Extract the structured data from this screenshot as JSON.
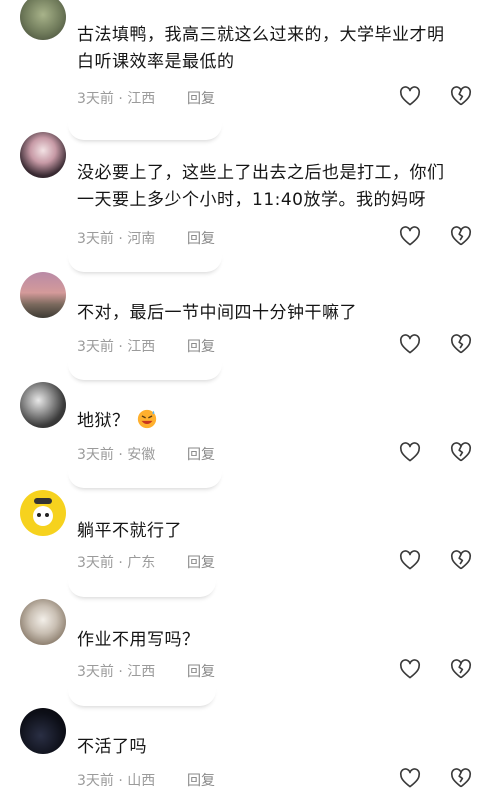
{
  "comments": [
    {
      "text": "古法填鸭，我高三就这么过来的，大学毕业才明白听课效率是最低的",
      "time": "3天前",
      "region": "江西",
      "reply": "回复"
    },
    {
      "text": "没必要上了，这些上了出去之后也是打工，你们一天要上多少个小时，11:40放学。我的妈呀",
      "time": "3天前",
      "region": "河南",
      "reply": "回复"
    },
    {
      "text": "不对，最后一节中间四十分钟干嘛了",
      "time": "3天前",
      "region": "江西",
      "reply": "回复"
    },
    {
      "text": "地狱？",
      "time": "3天前",
      "region": "安徽",
      "reply": "回复"
    },
    {
      "text": "躺平不就行了",
      "time": "3天前",
      "region": "广东",
      "reply": "回复"
    },
    {
      "text": "作业不用写吗？",
      "time": "3天前",
      "region": "江西",
      "reply": "回复"
    },
    {
      "text": "不活了吗",
      "time": "3天前",
      "region": "山西",
      "reply": "回复"
    }
  ],
  "icons": {
    "like": "heart-outline-icon",
    "dislike": "broken-heart-outline-icon",
    "emoji": "grinning-sweat-emoji"
  },
  "colors": {
    "text": "#151515",
    "meta": "#9b9b9b",
    "icon": "#3a3a3a"
  }
}
